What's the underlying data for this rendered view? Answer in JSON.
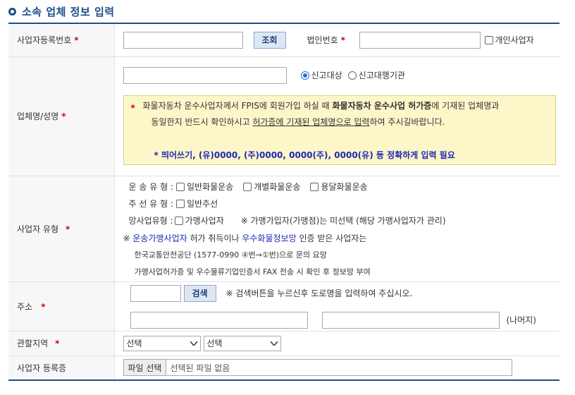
{
  "page": {
    "title": "소속 업체 정보 입력"
  },
  "rows": {
    "bizno": {
      "label": "사업자등록번호",
      "required": "*",
      "search_button": "조회",
      "corp_label": "법인번호",
      "corp_required": "*",
      "individual_label": "개인사업자"
    },
    "company": {
      "label": "업체명/성명",
      "required": "*",
      "radio_report": "신고대상",
      "radio_agency": "신고대행기관",
      "notice": {
        "star": "*",
        "line1_a": "화물자동차 운수사업자께서 FPIS에 회원가입 하실 때 ",
        "line1_b": "화물자동차 운수사업 허가증",
        "line1_c": "에 기재된 업체명과",
        "line2_a": "동일한지 반드시 확인하시고 ",
        "line2_b": "허가증에 기재된 업체명으로 입력",
        "line2_c": "하여 주시길바랍니다.",
        "line3": "* 띄어쓰기, (유)0000, (주)0000, 0000(주), 0000(유) 등 정확하게 입력 필요"
      }
    },
    "biztype": {
      "label": "사업자 유형",
      "required": "*",
      "transport_label": "운 송 유 형 :",
      "transport_opt1": "일반화물운송",
      "transport_opt2": "개별화물운송",
      "transport_opt3": "용달화물운송",
      "broker_label": "주 선 유 형 :",
      "broker_opt1": "일반주선",
      "network_label": "망사업유형 :",
      "network_opt1": "가맹사업자",
      "network_note": "※ 가맹가입자(가맹점)는 미선택 (해당 가맹사업자가 관리)",
      "info_prefix": "※ ",
      "info_link1": "운송가맹사업자",
      "info_mid": " 허가 취득이나 ",
      "info_link2": "우수화물정보망",
      "info_suffix": " 인증 받은 사업자는",
      "info_line2": "한국교통안전공단 (1577-0990 ④번→①번)으로 문의 요망",
      "info_line3": "가맹사업허가증 및 우수물류기업인증서 FAX 전송 시 확인 후 정보망 부여"
    },
    "address": {
      "label": "주소",
      "required": "*",
      "search_button": "검색",
      "hint": "※ 검색버튼을 누르신후 도로명을 입력하여 주십시오.",
      "rest_label": "(나머지)"
    },
    "region": {
      "label": "관할지역",
      "required": "*",
      "select1": "선택",
      "select2": "선택"
    },
    "certificate": {
      "label": "사업자 등록증",
      "file_button": "파일 선택",
      "file_status": "선택된 파일 없음"
    }
  },
  "colors": {
    "accent": "#1d4e89",
    "required": "#d40000",
    "notice_bg": "#fcf6c9",
    "link": "#1d2ab5"
  }
}
